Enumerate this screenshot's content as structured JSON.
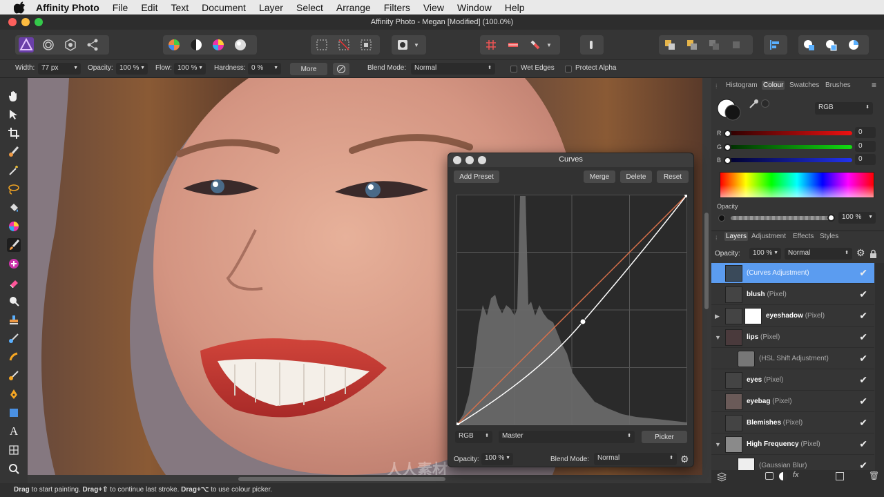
{
  "menubar": {
    "app": "Affinity Photo",
    "items": [
      "File",
      "Edit",
      "Text",
      "Document",
      "Layer",
      "Select",
      "Arrange",
      "Filters",
      "View",
      "Window",
      "Help"
    ]
  },
  "window": {
    "title": "Affinity Photo - Megan [Modified] (100.0%)"
  },
  "context": {
    "width_label": "Width:",
    "width_value": "77 px",
    "opacity_label": "Opacity:",
    "opacity_value": "100 %",
    "flow_label": "Flow:",
    "flow_value": "100 %",
    "hardness_label": "Hardness:",
    "hardness_value": "0 %",
    "more_label": "More",
    "blend_label": "Blend Mode:",
    "blend_value": "Normal",
    "wet_edges": "Wet Edges",
    "protect_alpha": "Protect Alpha"
  },
  "status": {
    "drag1": "Drag",
    "text1": " to start painting. ",
    "drag2": "Drag+⇧",
    "text2": " to continue last stroke. ",
    "drag3": "Drag+⌥",
    "text3": " to use colour picker."
  },
  "colour_panel": {
    "tabs": [
      "Histogram",
      "Colour",
      "Swatches",
      "Brushes"
    ],
    "selected_tab": "Colour",
    "model": "RGB",
    "r_label": "R",
    "r_value": "0",
    "g_label": "G",
    "g_value": "0",
    "b_label": "B",
    "b_value": "0",
    "opacity_label": "Opacity",
    "opacity_value": "100 %"
  },
  "layers_panel": {
    "tabs": [
      "Layers",
      "Adjustment",
      "Effects",
      "Styles"
    ],
    "selected_tab": "Layers",
    "opacity_label": "Opacity:",
    "opacity_value": "100 %",
    "blend_value": "Normal",
    "layers": [
      {
        "name": "",
        "kind": "(Curves Adjustment)",
        "selected": true,
        "expander": ""
      },
      {
        "name": "blush",
        "kind": " (Pixel)",
        "selected": false,
        "expander": ""
      },
      {
        "name": "eyeshadow",
        "kind": " (Pixel)",
        "selected": false,
        "expander": "▶"
      },
      {
        "name": "lips",
        "kind": " (Pixel)",
        "selected": false,
        "expander": "▼"
      },
      {
        "name": "",
        "kind": "(HSL Shift Adjustment)",
        "selected": false,
        "expander": "",
        "child": true
      },
      {
        "name": "eyes",
        "kind": " (Pixel)",
        "selected": false,
        "expander": ""
      },
      {
        "name": "eyebag",
        "kind": " (Pixel)",
        "selected": false,
        "expander": ""
      },
      {
        "name": "Blemishes",
        "kind": " (Pixel)",
        "selected": false,
        "expander": ""
      },
      {
        "name": "High Frequency",
        "kind": " (Pixel)",
        "selected": false,
        "expander": "▼"
      },
      {
        "name": "",
        "kind": "(Gaussian Blur)",
        "selected": false,
        "expander": "",
        "child": true
      }
    ]
  },
  "curves": {
    "title": "Curves",
    "add_preset": "Add Preset",
    "merge": "Merge",
    "delete": "Delete",
    "reset": "Reset",
    "channel": "RGB",
    "channel_mode": "Master",
    "picker": "Picker",
    "opacity_label": "Opacity:",
    "opacity_value": "100 %",
    "blend_label": "Blend Mode:",
    "blend_value": "Normal",
    "curve_point": [
      0.55,
      0.44
    ]
  },
  "watermark": "人人素材",
  "colors": {
    "accent": "#4a90e2",
    "layer_selected": "#5b9cf0",
    "curve_line": "#d8704a"
  }
}
